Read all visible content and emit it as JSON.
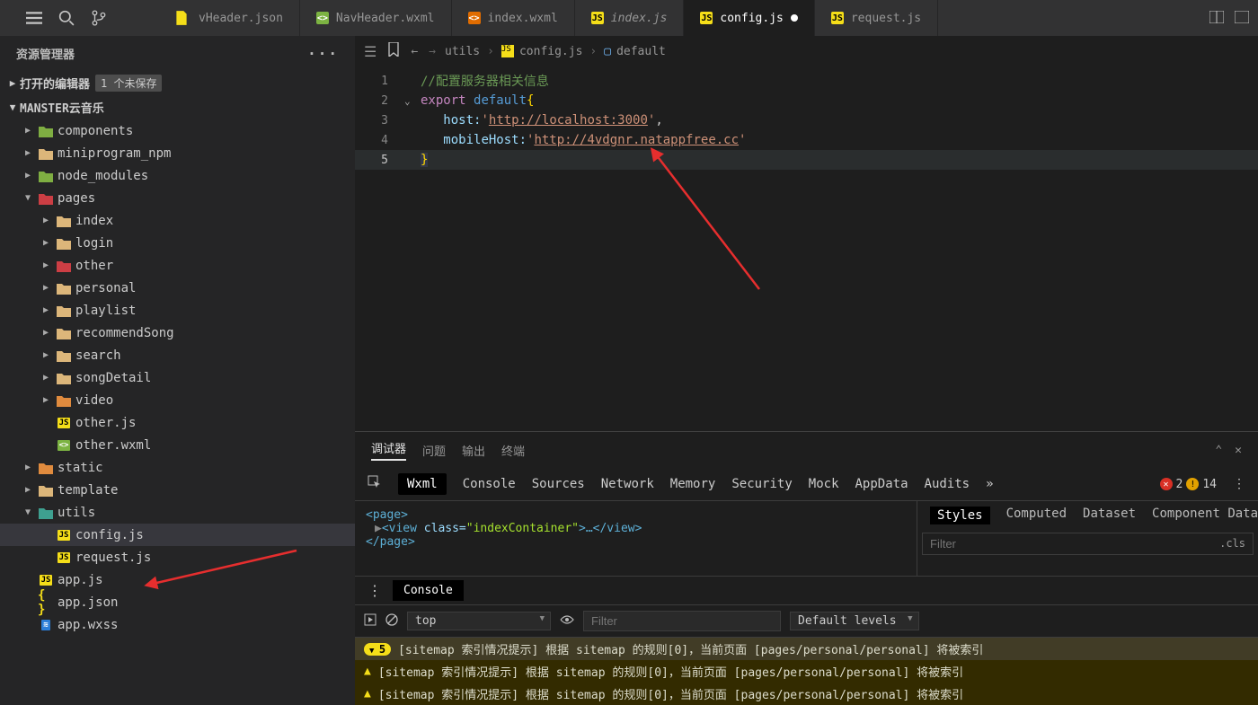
{
  "titlebar": {
    "tabs": [
      {
        "icon": "json",
        "name": "vHeader.json",
        "italic": false
      },
      {
        "icon": "wxml",
        "name": "NavHeader.wxml",
        "italic": false
      },
      {
        "icon": "wxml2",
        "name": "index.wxml",
        "italic": false
      },
      {
        "icon": "js",
        "name": "index.js",
        "italic": true
      },
      {
        "icon": "js",
        "name": "config.js",
        "italic": false,
        "active": true,
        "dirty": true
      },
      {
        "icon": "js",
        "name": "request.js",
        "italic": false
      }
    ]
  },
  "sidebar": {
    "title": "资源管理器",
    "sections": {
      "openEditors": {
        "label": "打开的编辑器",
        "badge": "1 个未保存"
      },
      "project": {
        "label": "MANSTER云音乐"
      }
    },
    "tree": {
      "components": "components",
      "miniprogram_npm": "miniprogram_npm",
      "node_modules": "node_modules",
      "pages": "pages",
      "pages_children": [
        "index",
        "login",
        "other",
        "personal",
        "playlist",
        "recommendSong",
        "search",
        "songDetail",
        "video"
      ],
      "other_js": "other.js",
      "other_wxml": "other.wxml",
      "static": "static",
      "template": "template",
      "utils": "utils",
      "config_js": "config.js",
      "request_js": "request.js",
      "app_js": "app.js",
      "app_json": "app.json",
      "app_wxss": "app.wxss"
    }
  },
  "breadcrumb": {
    "path": [
      "utils",
      "config.js",
      "default"
    ]
  },
  "code": {
    "l1": "//配置服务器相关信息",
    "l2a": "export",
    "l2b": "default",
    "l2c": "{",
    "l3a": "host:",
    "l3b": "'",
    "l3c": "http://localhost:3000",
    "l3d": "',",
    "l4a": "mobileHost:",
    "l4b": "'",
    "l4c": "http://4vdgnr.natappfree.cc",
    "l4d": "'",
    "l5": "}"
  },
  "terminalTabs": {
    "t1": "调试器",
    "t2": "问题",
    "t3": "输出",
    "t4": "终端"
  },
  "devtools": {
    "tabs": [
      "Wxml",
      "Console",
      "Sources",
      "Network",
      "Memory",
      "Security",
      "Mock",
      "AppData",
      "Audits"
    ],
    "more": "»",
    "errCount": "2",
    "warnCount": "14"
  },
  "wxml": {
    "open": "<page>",
    "view_open": "<view",
    "view_cls_attr": "class=",
    "view_cls_val": "\"indexContainer\"",
    "dots": ">…</view>",
    "close": "</page>"
  },
  "stylesPane": {
    "tabs": [
      "Styles",
      "Computed",
      "Dataset",
      "Component Data"
    ],
    "filterPlaceholder": "Filter",
    "cls": ".cls"
  },
  "consoleBar": {
    "label": "Console"
  },
  "consoleFilter": {
    "context": "top",
    "filterPlaceholder": "Filter",
    "levels": "Default levels"
  },
  "consoleLogs": {
    "badge": "5",
    "m1": "[sitemap 索引情况提示] 根据 sitemap 的规则[0]，当前页面 [pages/personal/personal] 将被索引",
    "m2": "[sitemap 索引情况提示] 根据 sitemap 的规则[0]，当前页面 [pages/personal/personal] 将被索引",
    "m3": "[sitemap 索引情况提示] 根据 sitemap 的规则[0]，当前页面 [pages/personal/personal] 将被索引"
  }
}
